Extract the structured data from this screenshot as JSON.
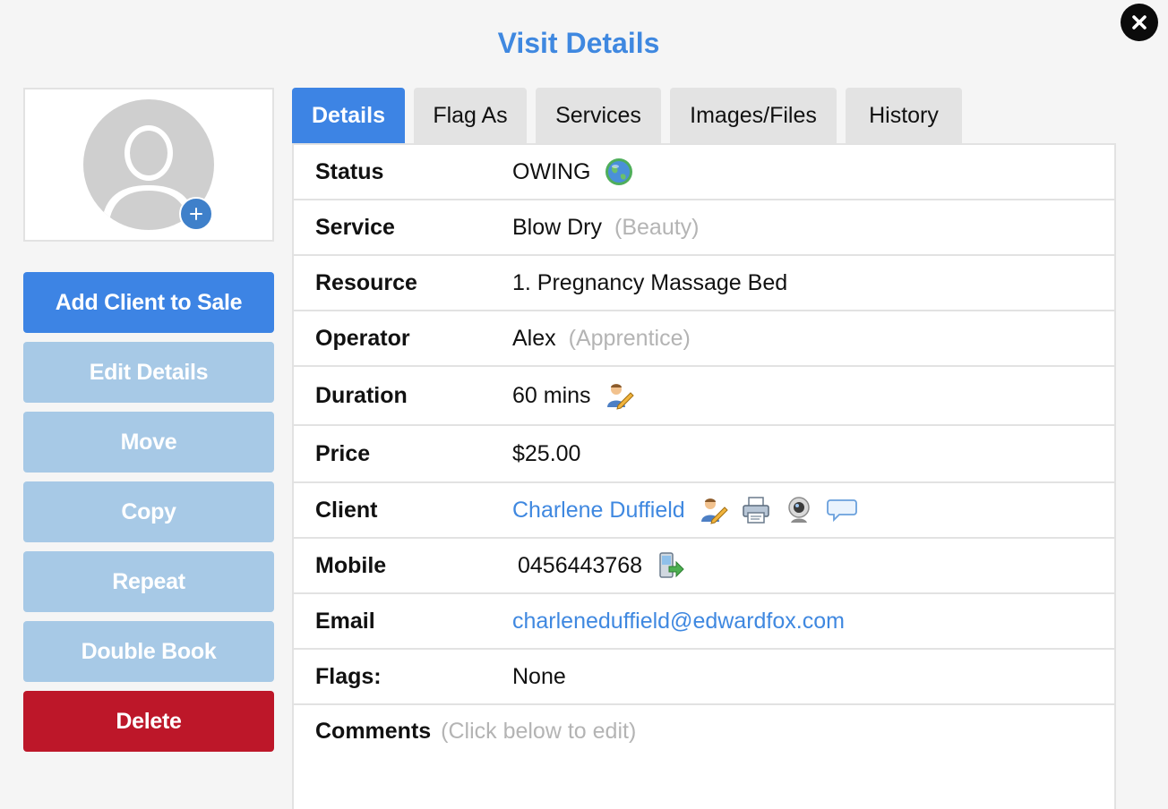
{
  "dialog": {
    "title": "Visit Details",
    "close_label": "×"
  },
  "avatar": {
    "add_label": "+"
  },
  "sidebar": {
    "buttons": [
      {
        "label": "Add Client to Sale"
      },
      {
        "label": "Edit Details"
      },
      {
        "label": "Move"
      },
      {
        "label": "Copy"
      },
      {
        "label": "Repeat"
      },
      {
        "label": "Double Book"
      },
      {
        "label": "Delete"
      }
    ]
  },
  "tabs": [
    {
      "label": "Details",
      "active": true
    },
    {
      "label": "Flag As"
    },
    {
      "label": "Services"
    },
    {
      "label": "Images/Files"
    },
    {
      "label": "History"
    }
  ],
  "details": {
    "status": {
      "label": "Status",
      "value": "OWING",
      "icon": "globe-icon"
    },
    "service": {
      "label": "Service",
      "value": "Blow Dry",
      "note": "(Beauty)"
    },
    "resource": {
      "label": "Resource",
      "value": "1. Pregnancy Massage Bed"
    },
    "operator": {
      "label": "Operator",
      "value": "Alex",
      "note": "(Apprentice)"
    },
    "duration": {
      "label": "Duration",
      "value": "60 mins",
      "icon": "edit-person-icon"
    },
    "price": {
      "label": "Price",
      "value": "$25.00"
    },
    "client": {
      "label": "Client",
      "value": "Charlene Duffield",
      "icons": [
        "edit-person-icon",
        "printer-icon",
        "webcam-icon",
        "speech-bubble-icon"
      ]
    },
    "mobile": {
      "label": "Mobile",
      "value": "0456443768",
      "icon": "send-sms-icon"
    },
    "email": {
      "label": "Email",
      "value": "charleneduffield@edwardfox.com"
    },
    "flags": {
      "label": "Flags:",
      "value": "None"
    },
    "comments": {
      "label": "Comments",
      "hint": "(Click below to edit)"
    }
  },
  "colors": {
    "accent": "#3d84e4",
    "title": "#3f88e0",
    "muted_button": "#a7c9e6",
    "danger": "#bd1729",
    "muted_text": "#b4b4b4"
  }
}
